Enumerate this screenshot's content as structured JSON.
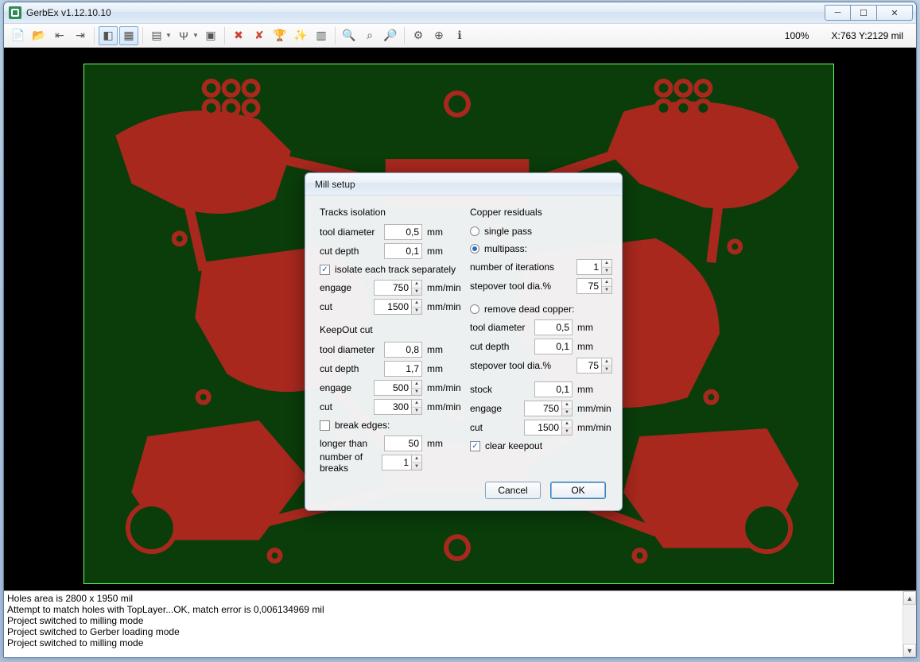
{
  "app": {
    "title": "GerbEx v1.12.10.10"
  },
  "toolbar": {
    "zoom": "100%",
    "coord": "X:763  Y:2129 mil",
    "icons": [
      "new-file-icon",
      "open-icon",
      "import-icon",
      "export-icon",
      "cube-icon",
      "board-icon",
      "layers-icon",
      "tools-icon",
      "settings-btn-icon",
      "delete-icon",
      "x-red-icon",
      "trophy-icon",
      "wand-icon",
      "layers2-icon",
      "zoom-in-icon",
      "zoom-fit-icon",
      "zoom-out-icon",
      "gear-icon",
      "target-icon",
      "info-icon"
    ]
  },
  "log": {
    "lines": [
      "Holes area is 2800 x 1950 mil",
      "Attempt to match holes with TopLayer...OK, match error is 0,006134969 mil",
      "Project switched to milling mode",
      "Project switched to Gerber loading mode",
      "Project switched to milling mode"
    ]
  },
  "dialog": {
    "title": "Mill setup",
    "tracks": {
      "heading": "Tracks isolation",
      "tool_diameter_label": "tool diameter",
      "tool_diameter_value": "0,5",
      "tool_diameter_unit": "mm",
      "cut_depth_label": "cut depth",
      "cut_depth_value": "0,1",
      "cut_depth_unit": "mm",
      "isolate_each_label": "isolate each track separately",
      "isolate_each_checked": true,
      "engage_label": "engage",
      "engage_value": "750",
      "engage_unit": "mm/min",
      "cut_label": "cut",
      "cut_value": "1500",
      "cut_unit": "mm/min"
    },
    "keepout": {
      "heading": "KeepOut cut",
      "tool_diameter_label": "tool diameter",
      "tool_diameter_value": "0,8",
      "tool_diameter_unit": "mm",
      "cut_depth_label": "cut depth",
      "cut_depth_value": "1,7",
      "cut_depth_unit": "mm",
      "engage_label": "engage",
      "engage_value": "500",
      "engage_unit": "mm/min",
      "cut_label": "cut",
      "cut_value": "300",
      "cut_unit": "mm/min",
      "break_edges_label": "break edges:",
      "break_edges_checked": false,
      "longer_than_label": "longer than",
      "longer_than_value": "50",
      "longer_than_unit": "mm",
      "num_breaks_label": "number of breaks",
      "num_breaks_value": "1"
    },
    "copper": {
      "heading": "Copper residuals",
      "single_pass_label": "single pass",
      "single_pass_selected": false,
      "multipass_label": "multipass:",
      "multipass_selected": true,
      "num_iter_label": "number of iterations",
      "num_iter_value": "1",
      "stepover_label": "stepover tool dia.%",
      "stepover_value": "75",
      "remove_dead_label": "remove dead copper:",
      "remove_dead_selected": false,
      "rd_tool_diameter_label": "tool diameter",
      "rd_tool_diameter_value": "0,5",
      "rd_tool_diameter_unit": "mm",
      "rd_cut_depth_label": "cut depth",
      "rd_cut_depth_value": "0,1",
      "rd_cut_depth_unit": "mm",
      "rd_stepover_label": "stepover tool dia.%",
      "rd_stepover_value": "75",
      "stock_label": "stock",
      "stock_value": "0,1",
      "stock_unit": "mm",
      "engage_label": "engage",
      "engage_value": "750",
      "engage_unit": "mm/min",
      "cut_label": "cut",
      "cut_value": "1500",
      "cut_unit": "mm/min",
      "clear_keepout_label": "clear keepout",
      "clear_keepout_checked": true
    },
    "buttons": {
      "cancel": "Cancel",
      "ok": "OK"
    }
  }
}
